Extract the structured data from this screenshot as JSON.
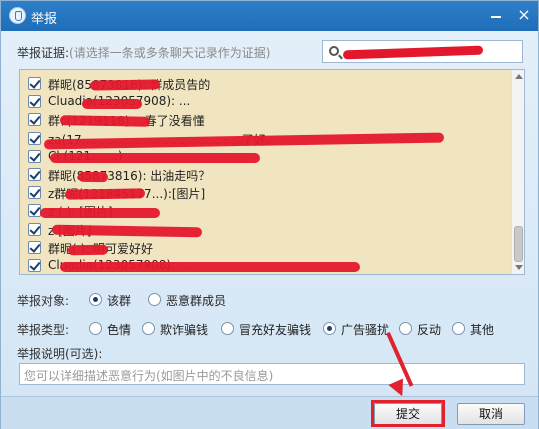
{
  "window": {
    "title": "举报",
    "icon": "shield-icon",
    "minimize_icon": "minimize-icon",
    "close_icon": "close-icon",
    "close_glyph": "×"
  },
  "evidence": {
    "label": "举报证据:",
    "hint": "(请选择一条或多条聊天记录作为证据)",
    "search_value": ""
  },
  "messages": [
    {
      "text": "群昵(85873816): 群成员告的",
      "checked": true
    },
    {
      "text": "Cluadia(123057908): ...",
      "checked": true
    },
    {
      "text": "群ɕ(1219118) ...春了没看懂",
      "checked": true
    },
    {
      "text": "za(17..........................................了好。",
      "checked": true
    },
    {
      "text": "Cl     (121.......)",
      "checked": true
    },
    {
      "text": "群昵(85873816): 出油走吗？",
      "checked": true
    },
    {
      "text": "z群昵(121845177...):[图片]",
      "checked": true
    },
    {
      "text": "z         (          ): [图片]",
      "checked": true
    },
    {
      "text": "z                    [图片]",
      "checked": true
    },
    {
      "text": "群昵(          ): 明可爱好好",
      "checked": true
    },
    {
      "text": "Cluadia(123057908): ...",
      "checked": true
    }
  ],
  "report_target": {
    "label": "举报对象:",
    "options": [
      {
        "label": "该群",
        "selected": true
      },
      {
        "label": "恶意群成员",
        "selected": false
      }
    ]
  },
  "report_type": {
    "label": "举报类型:",
    "options": [
      {
        "label": "色情",
        "selected": false
      },
      {
        "label": "欺诈骗钱",
        "selected": false
      },
      {
        "label": "冒充好友骗钱",
        "selected": false
      },
      {
        "label": "广告骚扰",
        "selected": true
      },
      {
        "label": "反动",
        "selected": false
      },
      {
        "label": "其他",
        "selected": false
      }
    ]
  },
  "description": {
    "label": "举报说明(可选):",
    "placeholder": "您可以详细描述恶意行为(如图片中的不良信息)"
  },
  "buttons": {
    "submit": "提交",
    "cancel": "取消"
  },
  "colors": {
    "titlebar": "#1f6db8",
    "list_bg": "#f1e4c1",
    "annotation_red": "#e0222f"
  }
}
